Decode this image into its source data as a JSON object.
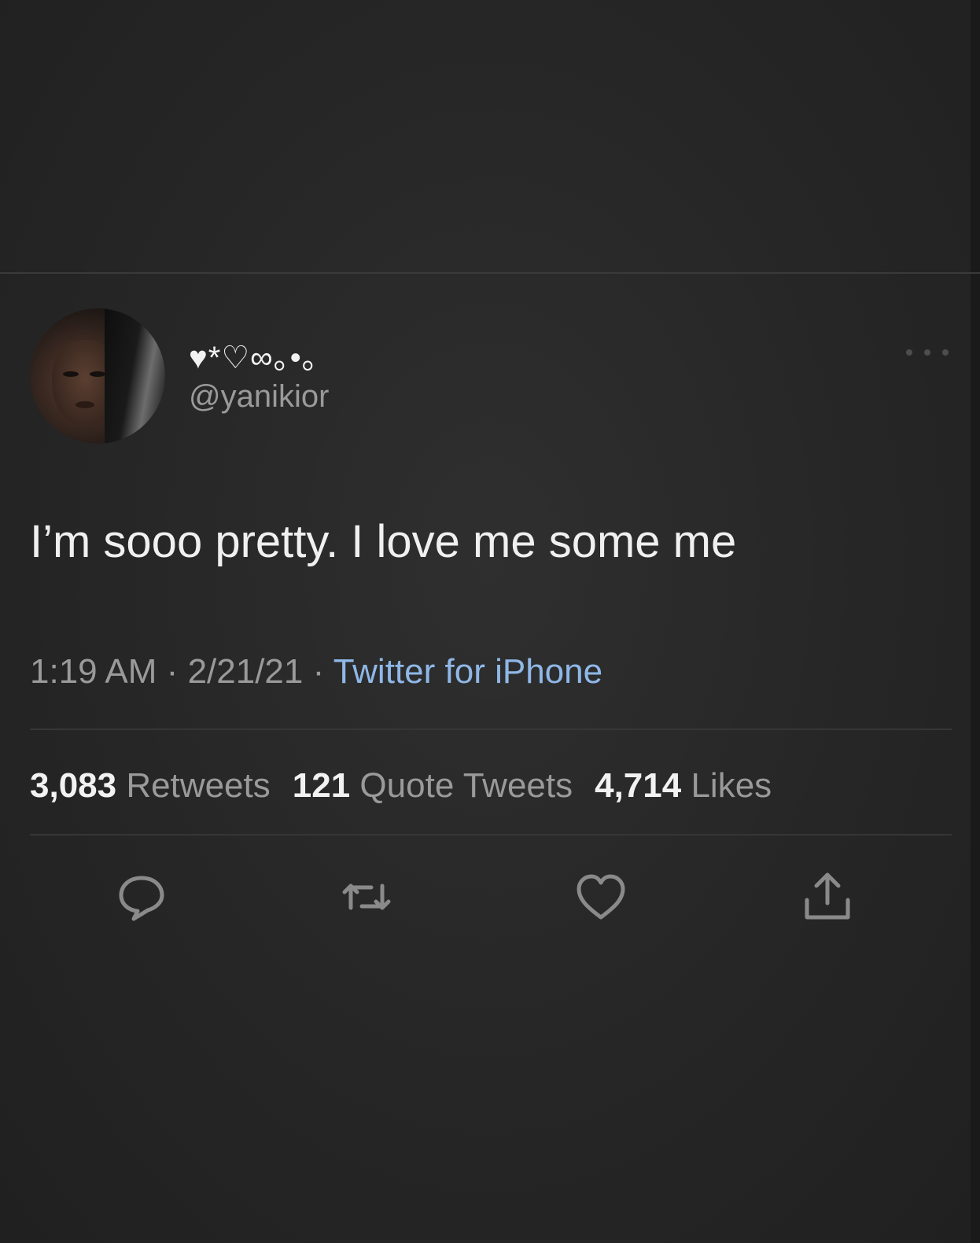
{
  "tweet": {
    "display_name": "♥*♡∞｡•｡",
    "handle": "@yanikior",
    "text": "I’m sooo pretty. I love me some me",
    "time": "1:19 AM",
    "date": "2/21/21",
    "source": "Twitter for iPhone",
    "separator": "·"
  },
  "stats": {
    "retweets_count": "3,083",
    "retweets_label": "Retweets",
    "quote_count": "121",
    "quote_label": "Quote Tweets",
    "likes_count": "4,714",
    "likes_label": "Likes"
  },
  "actions": [
    {
      "icon": "reply-icon"
    },
    {
      "icon": "retweet-icon"
    },
    {
      "icon": "like-icon"
    },
    {
      "icon": "share-icon"
    }
  ],
  "colors": {
    "background": "#262626",
    "text": "#f0f0f0",
    "muted": "#9a9a9a",
    "link": "#8fb8e8",
    "icon": "#8a8a8a"
  }
}
